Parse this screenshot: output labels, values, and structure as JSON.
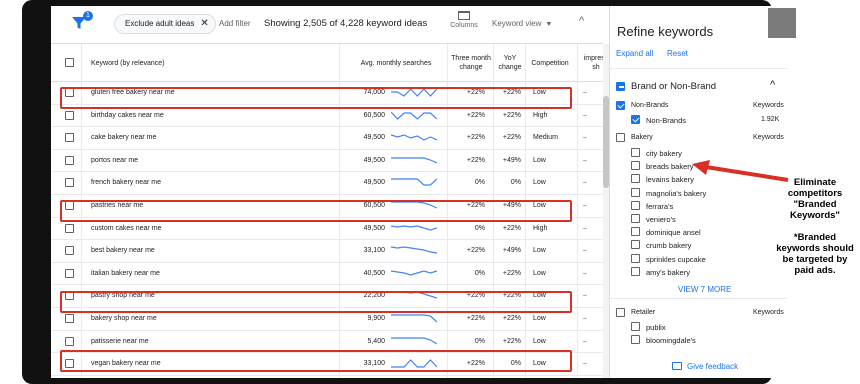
{
  "toolbar": {
    "filter_badge": "1",
    "chip_label": "Exclude adult ideas",
    "chip_close": "✕",
    "add_filter": "Add filter",
    "showing": "Showing 2,505 of 4,228 keyword ideas",
    "columns_label": "Columns",
    "keyword_view": "Keyword view",
    "collapse_glyph": "^"
  },
  "table": {
    "headers": {
      "keyword": "Keyword (by relevance)",
      "avg": "Avg. monthly searches",
      "three_month": "Three month change",
      "yoy": "YoY change",
      "competition": "Competition",
      "impressions": "impress sh"
    },
    "rows": [
      {
        "keyword": "gluten free bakery near me",
        "volume": "74,000",
        "three": "+22%",
        "yoy": "+22%",
        "competition": "Low",
        "impr": "–",
        "trend": [
          6,
          6,
          2,
          9,
          2,
          9,
          2,
          9
        ]
      },
      {
        "keyword": "birthday cakes near me",
        "volume": "60,500",
        "three": "+22%",
        "yoy": "+22%",
        "competition": "High",
        "impr": "–",
        "trend": [
          9,
          2,
          8,
          8,
          2,
          8,
          8,
          2
        ]
      },
      {
        "keyword": "cake bakery near me",
        "volume": "49,500",
        "three": "+22%",
        "yoy": "+22%",
        "competition": "Medium",
        "impr": "–",
        "trend": [
          8,
          6,
          8,
          5,
          7,
          3,
          6,
          3
        ]
      },
      {
        "keyword": "portos near me",
        "volume": "49,500",
        "three": "+22%",
        "yoy": "+49%",
        "competition": "Low",
        "impr": "–",
        "trend": [
          8,
          8,
          8,
          8,
          8,
          8,
          6,
          3
        ]
      },
      {
        "keyword": "french bakery near me",
        "volume": "49,500",
        "three": "0%",
        "yoy": "0%",
        "competition": "Low",
        "impr": "–",
        "trend": [
          9,
          9,
          9,
          9,
          9,
          3,
          3,
          9
        ]
      },
      {
        "keyword": "pastries near me",
        "volume": "60,500",
        "three": "+22%",
        "yoy": "+49%",
        "competition": "Low",
        "impr": "–",
        "trend": [
          9,
          9,
          9,
          9,
          9,
          8,
          6,
          3
        ]
      },
      {
        "keyword": "custom cakes near me",
        "volume": "49,500",
        "three": "0%",
        "yoy": "+22%",
        "competition": "High",
        "impr": "–",
        "trend": [
          8,
          7,
          8,
          7,
          8,
          6,
          4,
          6
        ]
      },
      {
        "keyword": "best bakery near me",
        "volume": "33,100",
        "three": "+22%",
        "yoy": "+49%",
        "competition": "Low",
        "impr": "–",
        "trend": [
          9,
          8,
          9,
          8,
          7,
          6,
          4,
          3
        ]
      },
      {
        "keyword": "italian bakery near me",
        "volume": "40,500",
        "three": "0%",
        "yoy": "+22%",
        "competition": "Low",
        "impr": "–",
        "trend": [
          8,
          7,
          6,
          4,
          6,
          8,
          6,
          8
        ]
      },
      {
        "keyword": "pastry shop near me",
        "volume": "22,200",
        "three": "+22%",
        "yoy": "+22%",
        "competition": "Low",
        "impr": "–",
        "trend": [
          9,
          9,
          9,
          8,
          9,
          7,
          5,
          3
        ]
      },
      {
        "keyword": "bakery shop near me",
        "volume": "9,900",
        "three": "+22%",
        "yoy": "+22%",
        "competition": "Low",
        "impr": "–",
        "trend": [
          9,
          9,
          9,
          9,
          9,
          9,
          8,
          2
        ]
      },
      {
        "keyword": "patisserie near me",
        "volume": "5,400",
        "three": "0%",
        "yoy": "+22%",
        "competition": "Low",
        "impr": "–",
        "trend": [
          9,
          9,
          9,
          9,
          9,
          9,
          7,
          3
        ]
      },
      {
        "keyword": "vegan bakery near me",
        "volume": "33,100",
        "three": "+22%",
        "yoy": "0%",
        "competition": "Low",
        "impr": "–",
        "trend": [
          2,
          2,
          2,
          9,
          2,
          2,
          9,
          2
        ]
      }
    ]
  },
  "panel": {
    "title": "Refine keywords",
    "close": "✕",
    "expand_all": "Expand all",
    "reset": "Reset",
    "brand_section": "Brand or Non-Brand",
    "collapse": "^",
    "non_brands_group": "Non-Brands",
    "keywords_col": "Keywords",
    "non_brands_item": "Non-Brands",
    "non_brands_count": "1.92K",
    "bakery_group": "Bakery",
    "bakery_items": [
      "city bakery",
      "breads bakery",
      "levains bakery",
      "magnolia's bakery",
      "ferrara's",
      "veniero's",
      "dominique ansel",
      "crumb bakery",
      "sprinkles cupcake",
      "amy's bakery"
    ],
    "view_more": "VIEW 7 MORE",
    "retailer_group": "Retailer",
    "retailer_items": [
      "publix",
      "bloomingdale's"
    ],
    "feedback": "Give feedback"
  },
  "annotation": {
    "line1": "Eliminate",
    "line2": "competitors",
    "line3": "\"Branded",
    "line4": "Keywords\"",
    "line5": "*Branded",
    "line6": "keywords should",
    "line7": "be targeted by",
    "line8": "paid ads."
  },
  "colors": {
    "accent": "#1a73e8",
    "highlight": "#d93025",
    "sparkline": "#4285f4"
  }
}
